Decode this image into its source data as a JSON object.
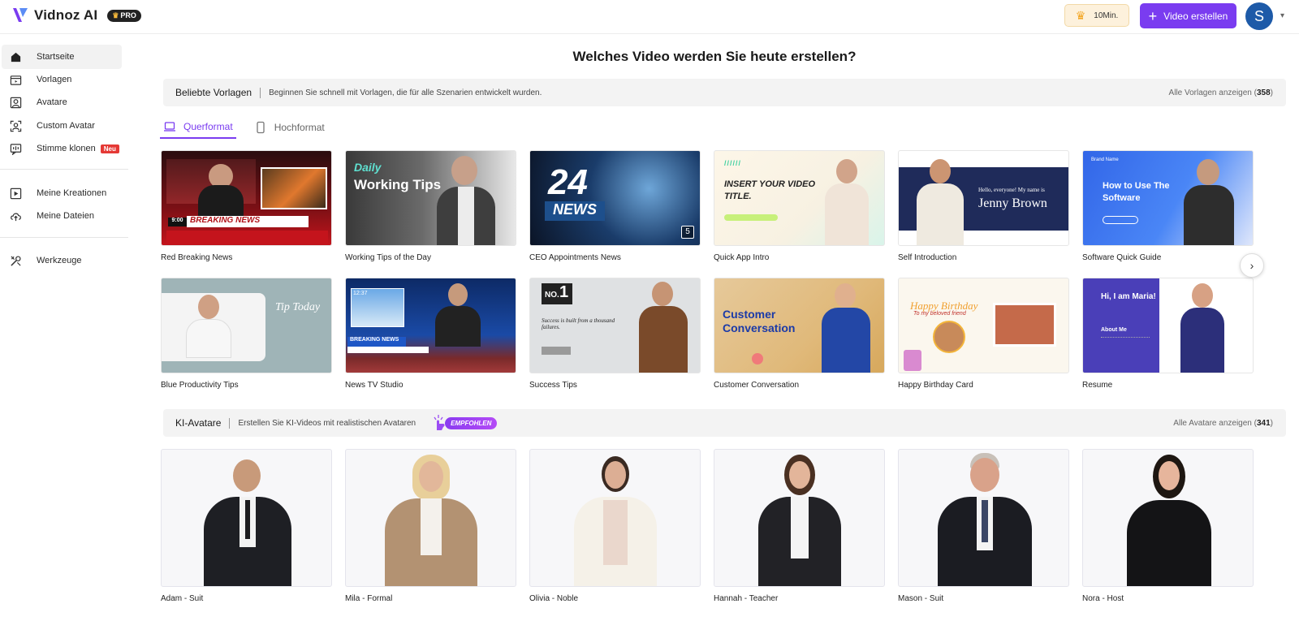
{
  "app": {
    "name": "Vidnoz AI",
    "badge": "PRO"
  },
  "header": {
    "credits": "10Min.",
    "create_label": "Video erstellen",
    "user_initial": "S"
  },
  "sidebar": {
    "items": [
      {
        "label": "Startseite",
        "icon": "home-icon",
        "active": true
      },
      {
        "label": "Vorlagen",
        "icon": "template-icon"
      },
      {
        "label": "Avatare",
        "icon": "avatar-icon"
      },
      {
        "label": "Custom Avatar",
        "icon": "custom-avatar-icon"
      },
      {
        "label": "Stimme klonen",
        "icon": "voice-clone-icon",
        "badge": "Neu"
      },
      {
        "label": "Meine Kreationen",
        "icon": "creations-icon"
      },
      {
        "label": "Meine Dateien",
        "icon": "upload-icon"
      },
      {
        "label": "Werkzeuge",
        "icon": "tools-icon"
      }
    ]
  },
  "main": {
    "headline": "Welches Video werden Sie heute erstellen?",
    "templates": {
      "title": "Beliebte Vorlagen",
      "desc": "Beginnen Sie schnell mit Vorlagen, die für alle Szenarien entwickelt wurden.",
      "link_text": "Alle Vorlagen anzeigen (",
      "count": "358",
      "link_end": ")",
      "tabs": [
        {
          "label": "Querformat",
          "active": true
        },
        {
          "label": "Hochformat"
        }
      ],
      "cards": [
        {
          "title": "Red Breaking News",
          "thumb_text": "BREAKING NEWS",
          "thumb_time": "9:00"
        },
        {
          "title": "Working Tips of the Day",
          "thumb_text": "Working Tips",
          "thumb_sub": "Daily"
        },
        {
          "title": "CEO Appointments News",
          "thumb_text": "24",
          "thumb_sub": "NEWS",
          "badge": "5"
        },
        {
          "title": "Quick App Intro",
          "thumb_text": "INSERT YOUR VIDEO TITLE."
        },
        {
          "title": "Self Introduction",
          "thumb_text": "Jenny Brown",
          "thumb_sub": "Hello, everyone! My name is"
        },
        {
          "title": "Software Quick Guide",
          "thumb_text": "How to Use The Software",
          "thumb_sub": "Brand Name"
        },
        {
          "title": "Blue Productivity Tips",
          "thumb_text": "Tip Today"
        },
        {
          "title": "News TV Studio",
          "thumb_text": "BREAKING NEWS",
          "thumb_time": "12:37"
        },
        {
          "title": "Success Tips",
          "thumb_text": "Success is built from a thousand failures.",
          "thumb_sub": "NO.",
          "num": "1"
        },
        {
          "title": "Customer Conversation",
          "thumb_text": "Customer Conversation"
        },
        {
          "title": "Happy Birthday Card",
          "thumb_text": "Happy Birthday",
          "thumb_sub": "To my beloved friend"
        },
        {
          "title": "Resume",
          "thumb_text": "Hi, I am Maria!",
          "thumb_sub": "About Me"
        }
      ]
    },
    "avatars": {
      "title": "KI-Avatare",
      "desc": "Erstellen Sie KI-Videos mit realistischen Avataren",
      "recommended": "EMPFOHLEN",
      "link_text": "Alle Avatare anzeigen (",
      "count": "341",
      "link_end": ")",
      "cards": [
        {
          "title": "Adam - Suit"
        },
        {
          "title": "Mila - Formal"
        },
        {
          "title": "Olivia - Noble"
        },
        {
          "title": "Hannah - Teacher"
        },
        {
          "title": "Mason - Suit"
        },
        {
          "title": "Nora - Host"
        }
      ]
    }
  },
  "colors": {
    "accent": "#7a3cf0",
    "neu_badge": "#e53935",
    "user_avatar": "#1d5aa8"
  }
}
